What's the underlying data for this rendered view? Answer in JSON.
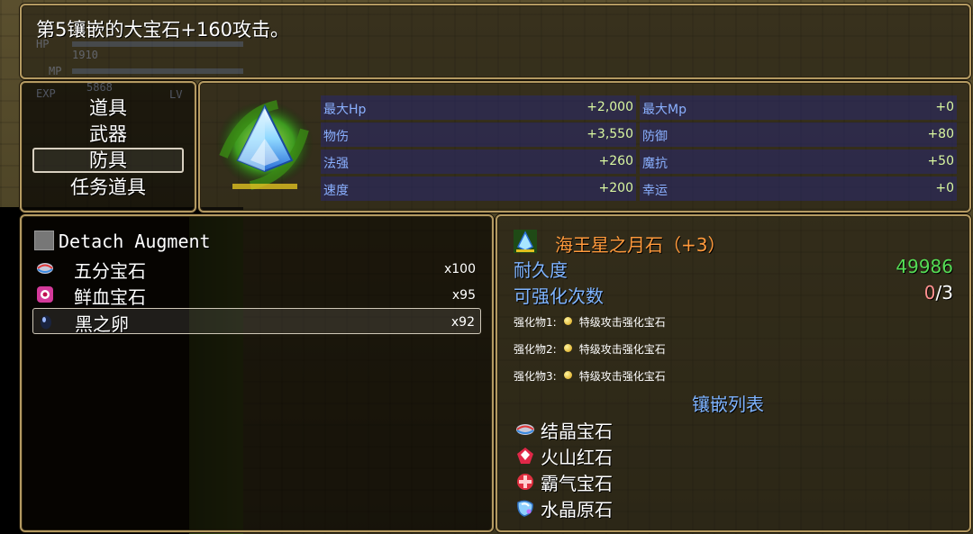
{
  "help": {
    "text": "第5镶嵌的大宝石+160攻击。"
  },
  "background_hud": {
    "hp": "HP",
    "hp_value": "1910",
    "mp": "MP",
    "exp": "EXP",
    "exp_value": "5868",
    "lv": "LV"
  },
  "categories": [
    {
      "label": "道具",
      "selected": false
    },
    {
      "label": "武器",
      "selected": false
    },
    {
      "label": "防具",
      "selected": true
    },
    {
      "label": "任务道具",
      "selected": false
    }
  ],
  "stats": {
    "left": [
      {
        "label": "最大Hp",
        "value": "+2,000"
      },
      {
        "label": "物伤",
        "value": "+3,550"
      },
      {
        "label": "法强",
        "value": "+260"
      },
      {
        "label": "速度",
        "value": "+200"
      }
    ],
    "right": [
      {
        "label": "最大Mp",
        "value": "+0"
      },
      {
        "label": "防御",
        "value": "+80"
      },
      {
        "label": "魔抗",
        "value": "+50"
      },
      {
        "label": "幸运",
        "value": "+0"
      }
    ]
  },
  "inventory": {
    "detach_label": "Detach Augment",
    "items": [
      {
        "name": "五分宝石",
        "qty": "x100",
        "icon": "swirl-gem-icon",
        "selected": false
      },
      {
        "name": "鲜血宝石",
        "qty": "x95",
        "icon": "blood-gem-icon",
        "selected": false
      },
      {
        "name": "黑之卵",
        "qty": "x92",
        "icon": "black-egg-icon",
        "selected": true
      }
    ]
  },
  "detail": {
    "name": "海王星之月石（+3）",
    "durability_label": "耐久度",
    "durability_value": "49986",
    "enhance_label": "可强化次数",
    "enhance_used": "0",
    "enhance_max": "/3",
    "enhancements": [
      {
        "slot": "强化物1:",
        "name": "特级攻击强化宝石"
      },
      {
        "slot": "强化物2:",
        "name": "特级攻击强化宝石"
      },
      {
        "slot": "强化物3:",
        "name": "特级攻击强化宝石"
      }
    ],
    "socket_title": "镶嵌列表",
    "sockets": [
      {
        "name": "结晶宝石",
        "icon": "crystal-gem-icon"
      },
      {
        "name": "火山红石",
        "icon": "volcano-red-stone-icon"
      },
      {
        "name": "霸气宝石",
        "icon": "domineering-gem-icon"
      },
      {
        "name": "水晶原石",
        "icon": "raw-crystal-icon"
      }
    ]
  },
  "colors": {
    "frame": "#b49a62",
    "stat_label": "#8ab0ff",
    "stat_value": "#d9f7a0",
    "item_name": "#ff9a3c",
    "detail_label": "#7fb4ff",
    "durability": "#55dd55",
    "enhance_used": "#ff9090"
  }
}
